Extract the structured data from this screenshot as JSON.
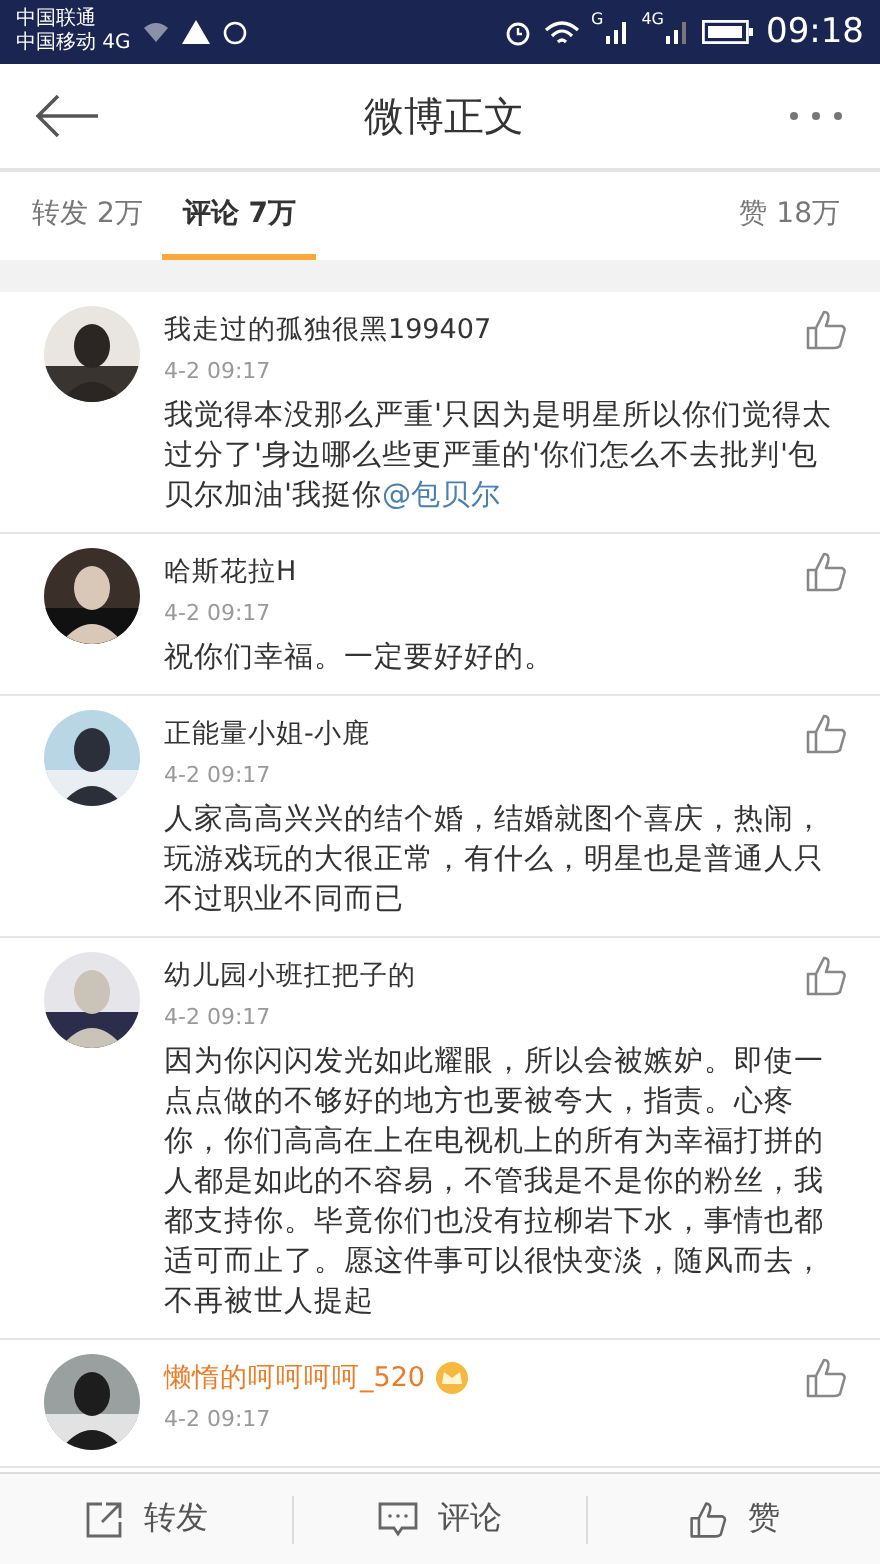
{
  "status_bar": {
    "carrier_1": "中国联通",
    "carrier_2": "中国移动 4G",
    "signal_1_label": "G",
    "signal_2_label": "4G",
    "time": "09:18"
  },
  "header": {
    "title": "微博正文"
  },
  "tabs": [
    {
      "label": "转发 2万",
      "selected": false
    },
    {
      "label": "评论 7万",
      "selected": true
    }
  ],
  "likes_tab": {
    "label": "赞 18万"
  },
  "comments": [
    {
      "name": "我走过的孤独很黑199407",
      "vip": false,
      "time": "4-2 09:17",
      "text": "我觉得本没那么严重'只因为是明星所以你们觉得太过分了'身边哪么些更严重的'你们怎么不去批判'包贝尔加油'我挺你",
      "mention": "@包贝尔"
    },
    {
      "name": "哈斯花拉H",
      "vip": false,
      "time": "4-2 09:17",
      "text": "祝你们幸福。一定要好好的。"
    },
    {
      "name": "正能量小姐-小鹿",
      "vip": false,
      "time": "4-2 09:17",
      "text": "人家高高兴兴的结个婚，结婚就图个喜庆，热闹，玩游戏玩的大很正常，有什么，明星也是普通人只不过职业不同而已"
    },
    {
      "name": "幼儿园小班扛把子的",
      "vip": false,
      "time": "4-2 09:17",
      "text": "因为你闪闪发光如此耀眼，所以会被嫉妒。即使一点点做的不够好的地方也要被夸大，指责。心疼你，你们高高在上在电视机上的所有为幸福打拼的人都是如此的不容易，不管我是不是你的粉丝，我都支持你。毕竟你们也没有拉柳岩下水，事情也都适可而止了。愿这件事可以很快变淡，随风而去，不再被世人提起"
    },
    {
      "name": "懒惰的呵呵呵呵_520",
      "vip": true,
      "time": "4-2 09:17"
    }
  ],
  "bottom_bar": [
    {
      "kind": "repost",
      "label": "转发"
    },
    {
      "kind": "comment",
      "label": "评论"
    },
    {
      "kind": "like",
      "label": "赞"
    }
  ]
}
